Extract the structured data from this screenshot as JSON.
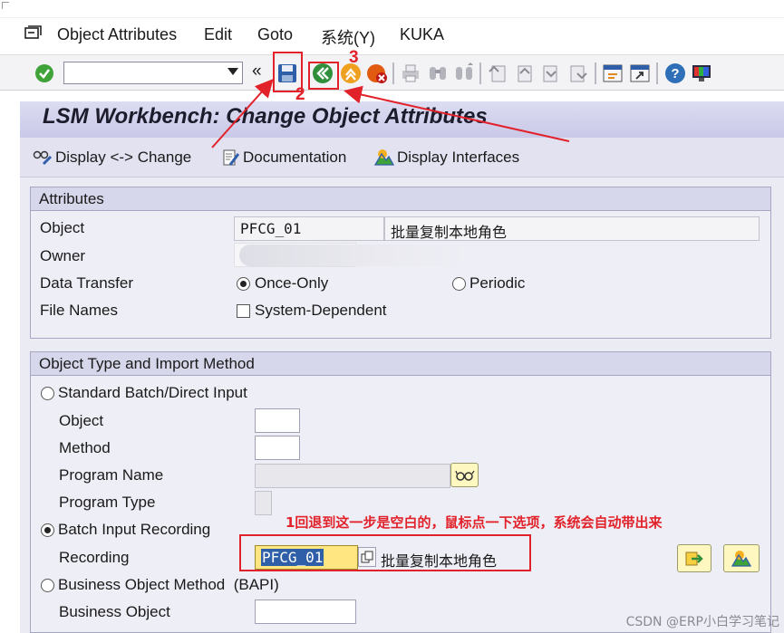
{
  "menu": {
    "items": [
      {
        "label": "Object Attributes"
      },
      {
        "label": "Edit"
      },
      {
        "label": "Goto"
      },
      {
        "label": "系统(Y)"
      },
      {
        "label": "KUKA"
      }
    ]
  },
  "toolbar": {
    "command_value": "",
    "arrows": "«"
  },
  "screen": {
    "title": "LSM Workbench: Change Object Attributes"
  },
  "app_toolbar": {
    "display_change": "Display <-> Change",
    "documentation": "Documentation",
    "display_interfaces": "Display Interfaces"
  },
  "attributes": {
    "header": "Attributes",
    "object_label": "Object",
    "object_value": "PFCG_01",
    "object_desc": "批量复制本地角色",
    "owner_label": "Owner",
    "data_transfer_label": "Data Transfer",
    "once_only": "Once-Only",
    "periodic": "Periodic",
    "file_names_label": "File Names",
    "system_dependent": "System-Dependent"
  },
  "import_method": {
    "header": "Object Type and Import Method",
    "standard_batch": "Standard Batch/Direct Input",
    "object_label": "Object",
    "method_label": "Method",
    "program_name_label": "Program Name",
    "program_type_label": "Program Type",
    "batch_input_recording": "Batch Input Recording",
    "recording_label": "Recording",
    "recording_value": "PFCG_01",
    "recording_desc": "批量复制本地角色",
    "bapi": "Business Object Method  (BAPI)",
    "business_object_label": "Business Object"
  },
  "annotations": {
    "n1_text": "1回退到这一步是空白的，鼠标点一下选项，系统会自动带出来",
    "n2": "2",
    "n3": "3"
  },
  "watermark": "CSDN @ERP小白学习笔记",
  "colors": {
    "annotation": "#e2222a",
    "title_bg": "#d2d2ec",
    "highlight_field": "#ffe680"
  }
}
